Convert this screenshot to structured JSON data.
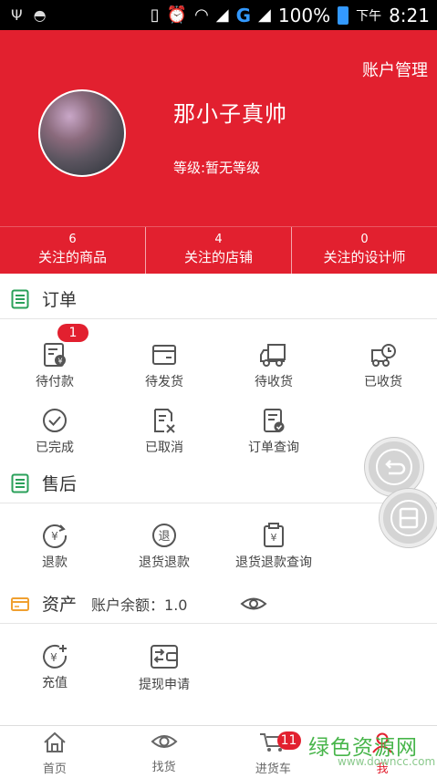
{
  "status_bar": {
    "network": "G",
    "battery_pct": "100%",
    "ampm": "下午",
    "time": "8:21"
  },
  "header": {
    "account_mgmt": "账户管理",
    "username": "那小子真帅",
    "level": "等级:暂无等级"
  },
  "stats": [
    {
      "num": "6",
      "label": "关注的商品"
    },
    {
      "num": "4",
      "label": "关注的店铺"
    },
    {
      "num": "0",
      "label": "关注的设计师"
    }
  ],
  "orders": {
    "title": "订单",
    "items": [
      {
        "label": "待付款",
        "icon": "wallet-doc-icon",
        "badge": "1"
      },
      {
        "label": "待发货",
        "icon": "box-icon"
      },
      {
        "label": "待收货",
        "icon": "truck-icon"
      },
      {
        "label": "已收货",
        "icon": "delivery-clock-icon"
      },
      {
        "label": "已完成",
        "icon": "check-circle-icon"
      },
      {
        "label": "已取消",
        "icon": "doc-cancel-icon"
      },
      {
        "label": "订单查询",
        "icon": "doc-search-icon"
      }
    ]
  },
  "aftersale": {
    "title": "售后",
    "items": [
      {
        "label": "退款",
        "icon": "refund-icon"
      },
      {
        "label": "退货退款",
        "icon": "return-refund-icon"
      },
      {
        "label": "退货退款查询",
        "icon": "refund-query-icon"
      }
    ]
  },
  "assets": {
    "title": "资产",
    "balance": "账户余额：1.0",
    "items": [
      {
        "label": "充值",
        "icon": "recharge-icon"
      },
      {
        "label": "提现申请",
        "icon": "withdraw-icon"
      }
    ]
  },
  "bottom_nav": [
    {
      "label": "首页",
      "icon": "home-icon"
    },
    {
      "label": "找货",
      "icon": "eye-icon"
    },
    {
      "label": "进货车",
      "icon": "cart-icon",
      "badge": "11"
    },
    {
      "label": "我",
      "icon": "user-icon"
    }
  ],
  "watermark": {
    "text": "绿色资源网",
    "sub": "www.downcc.com"
  },
  "colors": {
    "brand": "#e2202f",
    "section_icon": "#2aa05a",
    "asset_icon": "#f0a030"
  }
}
